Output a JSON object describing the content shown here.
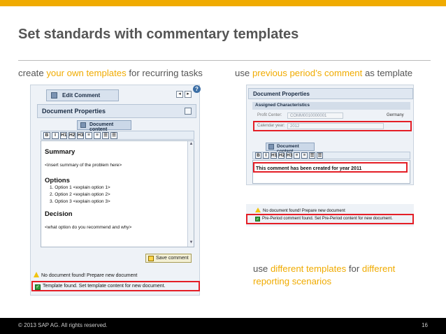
{
  "slide": {
    "title": "Set standards with commentary templates",
    "page_number": "16",
    "copyright": "© 2013 SAP AG. All rights reserved."
  },
  "captions": {
    "left": {
      "pre": "create ",
      "highlight": "your own templates",
      "post": " for recurring tasks"
    },
    "right": {
      "pre": "use ",
      "highlight": "previous period’s comment",
      "post": " as template"
    },
    "bottom": {
      "pre": "use ",
      "highlight1": "different templates",
      "mid": " for ",
      "highlight2": "different",
      "line2_highlight": "reporting scenarios"
    }
  },
  "left_screen": {
    "tab_label": "Edit Comment",
    "panel_title": "Document Properties",
    "content_tab": "Document content",
    "toolbar_buttons": [
      "B",
      "I",
      "H1",
      "H2",
      "H3",
      "≡",
      "≡",
      "☰",
      "☰"
    ],
    "editor": {
      "summary_heading": "Summary",
      "summary_text": "<insert summary of the problem here>",
      "options_heading": "Options",
      "options": [
        "1.   Option 1 <explain option 1>",
        "2.   Option 2 <explain option 2>",
        "3.   Option 3 <explain option 3>"
      ],
      "decision_heading": "Decision",
      "decision_text": "<what option do you recommend and why>"
    },
    "save_label": "Save comment",
    "messages": {
      "warning": "No document found! Prepare new document",
      "success": "Template found. Set template content for new document."
    }
  },
  "right_screen": {
    "panel_title": "Document Properties",
    "assigned_heading": "Assigned Characteristics",
    "fields": [
      {
        "label": "Profit Center:",
        "value": "COMM0010000001",
        "extra": "Germany"
      },
      {
        "label": "Calendar year:",
        "value": "2012"
      }
    ],
    "content_tab": "Document content",
    "toolbar_buttons": [
      "B",
      "I",
      "H1",
      "H2",
      "H3",
      "≡",
      "≡",
      "☰",
      "☰"
    ],
    "editor_text": "This comment has been created for year 2011"
  },
  "right_messages": {
    "warning": "No document found! Prepare new document",
    "success": "Pre-Period comment found. Set Pre-Period content for new document."
  },
  "colors": {
    "accent": "#f0ab00",
    "highlight_box": "#e41e26",
    "title": "#555555"
  }
}
